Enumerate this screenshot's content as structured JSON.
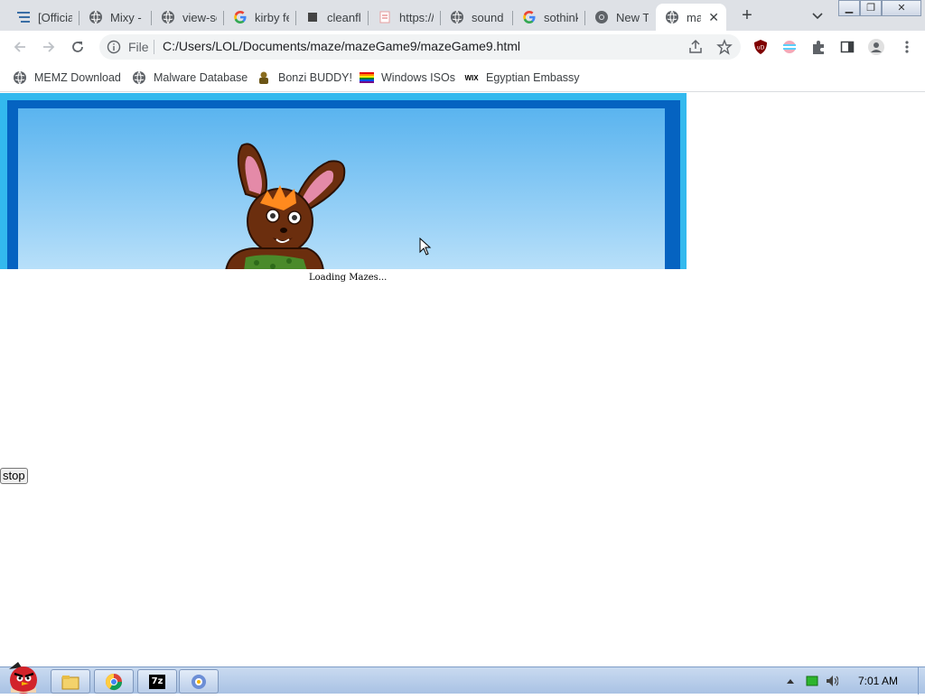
{
  "tabs": [
    {
      "title": "[Officia",
      "icon": "list-icon"
    },
    {
      "title": "Mixy -",
      "icon": "globe-icon"
    },
    {
      "title": "view-sc",
      "icon": "globe-icon"
    },
    {
      "title": "kirby fe",
      "icon": "google-icon"
    },
    {
      "title": "cleanfla",
      "icon": "square-icon"
    },
    {
      "title": "https://",
      "icon": "page-icon"
    },
    {
      "title": "sound",
      "icon": "globe-icon"
    },
    {
      "title": "sothink",
      "icon": "google-icon"
    },
    {
      "title": "New Ta",
      "icon": "chrome-icon"
    },
    {
      "title": "ma",
      "icon": "globe-icon"
    }
  ],
  "active_tab_index": 9,
  "address_bar": {
    "scheme_label": "File",
    "url": "C:/Users/LOL/Documents/maze/mazeGame9/mazeGame9.html"
  },
  "bookmarks": [
    {
      "label": "MEMZ Download",
      "icon": "globe-icon"
    },
    {
      "label": "Malware Database",
      "icon": "globe-icon"
    },
    {
      "label": "Bonzi BUDDY!",
      "icon": "bonzi-icon"
    },
    {
      "label": "Windows ISOs",
      "icon": "windows-flag-icon"
    },
    {
      "label": "Egyptian Embassy",
      "icon": "wix-icon"
    }
  ],
  "wix_icon_text": "WIX",
  "page": {
    "loading_text": "Loading Mazes...",
    "stop_button": "stop"
  },
  "taskbar": {
    "apps": [
      "angry-bird-start-icon",
      "explorer-icon",
      "chrome-icon",
      "7zip-icon",
      "app-icon"
    ],
    "sevenzip_label": "7z",
    "clock": "7:01 AM"
  },
  "colors": {
    "game_border": "#33b9ee",
    "game_frame": "#0563c1",
    "sky": "#5ab4ef",
    "taskbar": "#b9cde9"
  }
}
